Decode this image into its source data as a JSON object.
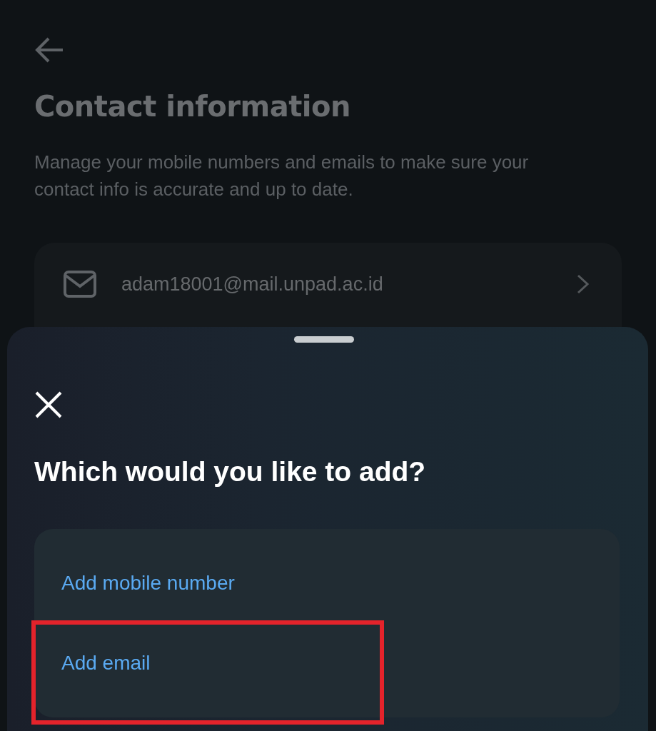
{
  "page": {
    "title": "Contact information",
    "description": "Manage your mobile numbers and emails to make sure your contact info is accurate and up to date.",
    "contacts": [
      {
        "kind": "email",
        "value": "adam18001@mail.unpad.ac.id"
      }
    ]
  },
  "sheet": {
    "heading": "Which would you like to add?",
    "options": [
      {
        "label": "Add mobile number",
        "highlighted": false
      },
      {
        "label": "Add email",
        "highlighted": true
      }
    ]
  }
}
